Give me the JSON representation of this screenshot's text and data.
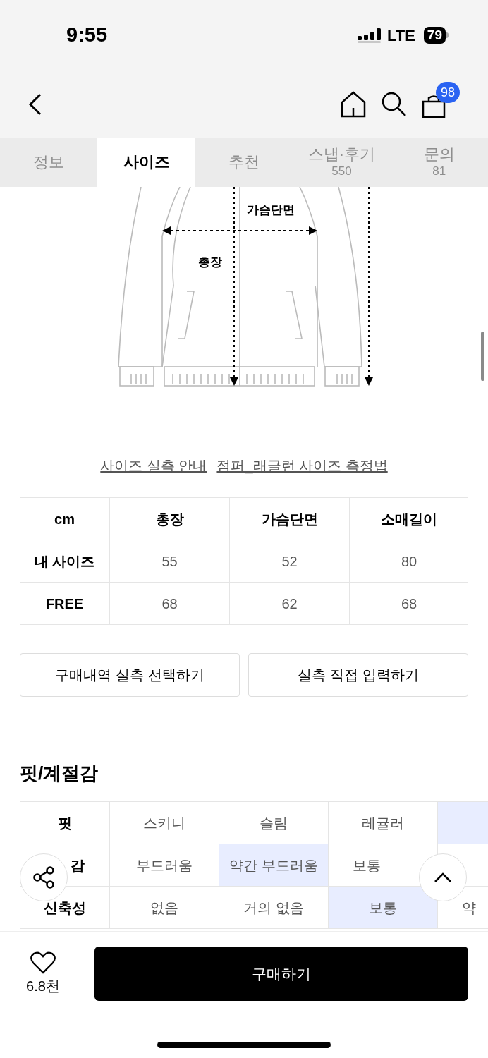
{
  "status_bar": {
    "time": "9:55",
    "network": "LTE",
    "battery": "79"
  },
  "nav": {
    "cart_badge": "98"
  },
  "tabs": [
    {
      "label": "정보",
      "selected": false
    },
    {
      "label": "사이즈",
      "selected": true
    },
    {
      "label": "추천",
      "selected": false
    },
    {
      "label": "스냅·후기",
      "count": "550",
      "selected": false
    },
    {
      "label": "문의",
      "count": "81",
      "selected": false
    }
  ],
  "diagram": {
    "labels": [
      "가슴단면",
      "총장"
    ]
  },
  "size_links": [
    "사이즈 실측 안내",
    "점퍼_래글런 사이즈 측정법"
  ],
  "size_table": {
    "columns": [
      "cm",
      "총장",
      "가슴단면",
      "소매길이"
    ],
    "rows": [
      {
        "label": "내 사이즈",
        "values": [
          "55",
          "52",
          "80"
        ]
      },
      {
        "label": "FREE",
        "values": [
          "68",
          "62",
          "68"
        ]
      }
    ]
  },
  "size_buttons": [
    "구매내역 실측 선택하기",
    "실측 직접 입력하기"
  ],
  "fit": {
    "title": "핏/계절감",
    "rows": [
      {
        "label": "핏",
        "kind": "full",
        "options": [
          {
            "text": "스키니",
            "selected": false
          },
          {
            "text": "슬림",
            "selected": false
          },
          {
            "text": "레귤러",
            "selected": false
          },
          {
            "selected": true
          }
        ]
      },
      {
        "label": "감",
        "kind": "covered",
        "options": [
          {
            "text": "부드러움",
            "selected": false
          },
          {
            "text": "약간 부드러움",
            "selected": true
          },
          {
            "text": "보통",
            "selected": false
          }
        ]
      },
      {
        "label": "신축성",
        "kind": "full",
        "options": [
          {
            "text": "없음",
            "selected": false
          },
          {
            "text": "거의 없음",
            "selected": false
          },
          {
            "text": "보통",
            "selected": true
          },
          {
            "text": "약",
            "selected": false
          }
        ]
      }
    ]
  },
  "bottom_bar": {
    "like_count": "6.8천",
    "buy_button": "구매하기"
  }
}
